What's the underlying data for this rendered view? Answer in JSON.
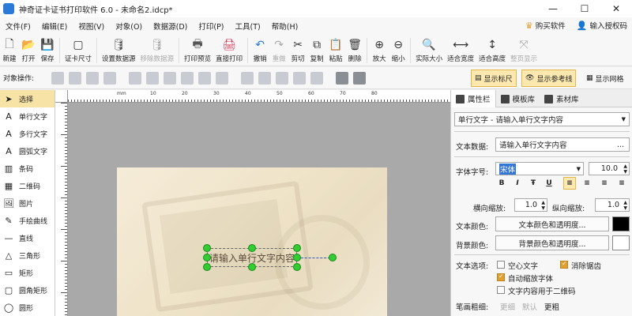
{
  "window": {
    "title": "神奇证卡证书打印软件 6.0 - 未命名2.idcp*",
    "minimize": "—",
    "maximize": "☐",
    "close": "✕"
  },
  "menu": {
    "items": [
      "文件(F)",
      "编辑(E)",
      "视图(V)",
      "对象(O)",
      "数据源(D)",
      "打印(P)",
      "工具(T)",
      "帮助(H)"
    ],
    "buy": "购买软件",
    "license": "输入授权码"
  },
  "toolbar": {
    "items": [
      {
        "label": "新建",
        "icon": "new-file-icon",
        "glyph": "🗋",
        "enabled": true
      },
      {
        "label": "打开",
        "icon": "open-icon",
        "glyph": "📂",
        "enabled": true
      },
      {
        "label": "保存",
        "icon": "save-icon",
        "glyph": "💾",
        "enabled": true
      },
      {
        "label": "证卡尺寸",
        "icon": "card-size-icon",
        "glyph": "▢",
        "enabled": true
      },
      {
        "label": "设置数据源",
        "icon": "database-icon",
        "glyph": "🛢",
        "enabled": true
      },
      {
        "label": "移除数据源",
        "icon": "remove-database-icon",
        "glyph": "🛢",
        "enabled": false
      },
      {
        "label": "打印预览",
        "icon": "print-preview-icon",
        "glyph": "🖶",
        "enabled": true
      },
      {
        "label": "直接打印",
        "icon": "print-icon",
        "glyph": "🖨",
        "enabled": true
      },
      {
        "label": "撤销",
        "icon": "undo-icon",
        "glyph": "↶",
        "enabled": true
      },
      {
        "label": "重做",
        "icon": "redo-icon",
        "glyph": "↷",
        "enabled": false
      },
      {
        "label": "剪切",
        "icon": "cut-icon",
        "glyph": "✂",
        "enabled": true
      },
      {
        "label": "复制",
        "icon": "copy-icon",
        "glyph": "⧉",
        "enabled": true
      },
      {
        "label": "粘贴",
        "icon": "paste-icon",
        "glyph": "📋",
        "enabled": true
      },
      {
        "label": "删除",
        "icon": "delete-icon",
        "glyph": "🗑",
        "enabled": true
      },
      {
        "label": "放大",
        "icon": "zoom-in-icon",
        "glyph": "⊕",
        "enabled": true
      },
      {
        "label": "缩小",
        "icon": "zoom-out-icon",
        "glyph": "⊖",
        "enabled": true
      },
      {
        "label": "实际大小",
        "icon": "actual-size-icon",
        "glyph": "🔍",
        "enabled": true
      },
      {
        "label": "适合宽度",
        "icon": "fit-width-icon",
        "glyph": "⟷",
        "enabled": true
      },
      {
        "label": "适合高度",
        "icon": "fit-height-icon",
        "glyph": "↕",
        "enabled": true
      },
      {
        "label": "整页显示",
        "icon": "full-page-icon",
        "glyph": "⤧",
        "enabled": false
      }
    ]
  },
  "objbar": {
    "label": "对象操作:",
    "show_ruler": "显示标尺",
    "show_guides": "显示参考线",
    "show_grid": "显示网格"
  },
  "tools": [
    {
      "label": "选择",
      "icon": "cursor-icon",
      "glyph": "➤",
      "active": true
    },
    {
      "label": "单行文字",
      "icon": "single-text-icon",
      "glyph": "A",
      "active": false
    },
    {
      "label": "多行文字",
      "icon": "multi-text-icon",
      "glyph": "A",
      "active": false
    },
    {
      "label": "圆弧文字",
      "icon": "arc-text-icon",
      "glyph": "A",
      "active": false
    },
    {
      "label": "条码",
      "icon": "barcode-icon",
      "glyph": "▥",
      "active": false
    },
    {
      "label": "二维码",
      "icon": "qrcode-icon",
      "glyph": "▦",
      "active": false
    },
    {
      "label": "图片",
      "icon": "image-icon",
      "glyph": "🖼",
      "active": false
    },
    {
      "label": "手绘曲线",
      "icon": "pen-icon",
      "glyph": "✎",
      "active": false
    },
    {
      "label": "直线",
      "icon": "line-icon",
      "glyph": "—",
      "active": false
    },
    {
      "label": "三角形",
      "icon": "triangle-icon",
      "glyph": "△",
      "active": false
    },
    {
      "label": "矩形",
      "icon": "rectangle-icon",
      "glyph": "▭",
      "active": false
    },
    {
      "label": "圆角矩形",
      "icon": "rounded-rect-icon",
      "glyph": "▢",
      "active": false
    },
    {
      "label": "圆形",
      "icon": "circle-icon",
      "glyph": "◯",
      "active": false
    }
  ],
  "canvas": {
    "ruler_labels": [
      "0",
      "10",
      "20",
      "30",
      "40",
      "50",
      "60",
      "70",
      "80"
    ],
    "ruler_unit": "mm",
    "text_object": "请输入单行文字内容"
  },
  "panel": {
    "tabs": [
      "属性栏",
      "模板库",
      "素材库"
    ],
    "object_select": "单行文字 - 请输入单行文字内容",
    "text_data_label": "文本数据:",
    "text_data_value": "请输入单行文字内容",
    "more": "...",
    "font_label": "字体字号:",
    "font_name": "宋体",
    "font_size": "10.0",
    "format": {
      "bold": "B",
      "italic": "I",
      "strike": "Ŧ",
      "underline": "U"
    },
    "hscale_label": "横向缩放:",
    "hscale_value": "1.0",
    "vscale_label": "纵向缩放:",
    "vscale_value": "1.0",
    "text_color_label": "文本颜色:",
    "text_color_btn": "文本颜色和透明度...",
    "bg_color_label": "背景颜色:",
    "bg_color_btn": "背景颜色和透明度...",
    "options_label": "文本选项:",
    "opt_hollow": "空心文字",
    "opt_antialias": "消除锯齿",
    "opt_autoscale": "自动缩放字体",
    "opt_qr": "文字内容用于二维码",
    "stroke_label": "笔画粗细:",
    "stroke_thin": "更细",
    "stroke_default": "默认",
    "stroke_thick": "更粗"
  }
}
